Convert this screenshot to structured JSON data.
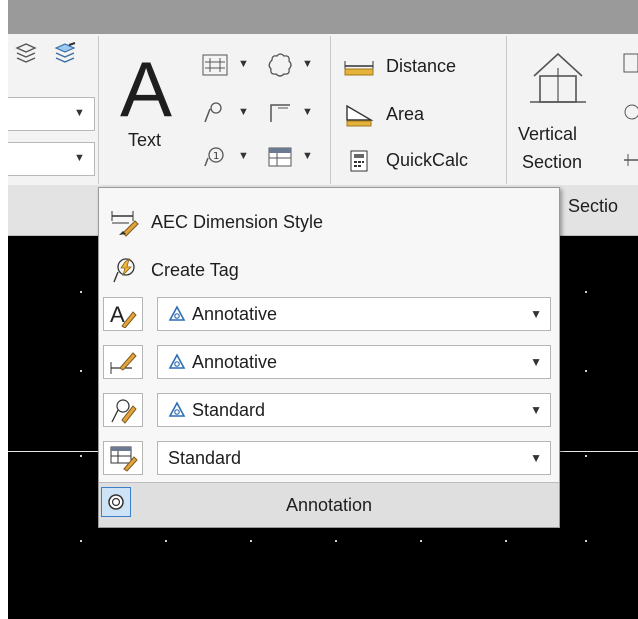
{
  "ribbon": {
    "text_button_label": "Text",
    "measure": {
      "distance_label": "Distance",
      "area_label": "Area",
      "quickcalc_label": "QuickCalc"
    },
    "vertical_section_label_line1": "Vertical",
    "vertical_section_label_line2": "Section",
    "sections_panel_title_partial": "Sectio"
  },
  "flyout": {
    "aec_dimension_style_label": "AEC Dimension Style",
    "create_tag_label": "Create Tag",
    "text_style_value": "Annotative",
    "dimension_style_value": "Annotative",
    "multileader_style_value": "Standard",
    "table_style_value": "Standard",
    "panel_title": "Annotation"
  },
  "icons": {
    "annotative_symbol": "annotative-icon"
  }
}
